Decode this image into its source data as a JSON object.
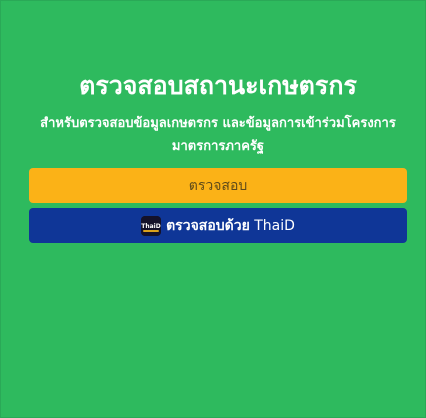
{
  "page": {
    "title": "ตรวจสอบสถานะเกษตรกร",
    "subtitle": "สำหรับตรวจสอบข้อมูลเกษตรกร และข้อมูลการเข้าร่วมโครงการมาตรการภาครัฐ"
  },
  "buttons": {
    "check_label": "ตรวจสอบ",
    "thaid_prefix": "ตรวจสอบด้วย",
    "thaid_brand": "ThaiD",
    "thaid_logo_text": "ThaiD"
  },
  "colors": {
    "background": "#2eba5e",
    "check_button": "#fbb217",
    "thaid_button": "#0f3697"
  }
}
